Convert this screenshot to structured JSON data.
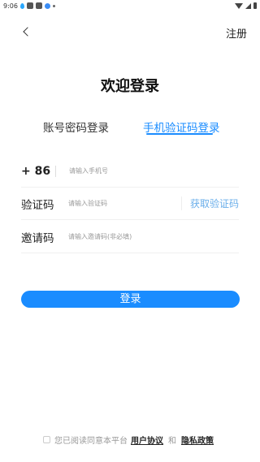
{
  "status_bar": {
    "time": "9:06"
  },
  "header": {
    "register_label": "注册"
  },
  "title": "欢迎登录",
  "tabs": [
    {
      "label": "账号密码登录",
      "active": false
    },
    {
      "label": "手机验证码登录",
      "active": true
    }
  ],
  "form": {
    "phone": {
      "prefix": "+ 86",
      "placeholder": "请输入手机号",
      "value": ""
    },
    "code": {
      "label": "验证码",
      "placeholder": "请输入验证码",
      "value": "",
      "get_code_label": "获取验证码"
    },
    "invite": {
      "label": "邀请码",
      "placeholder": "请输入邀请码(非必填)",
      "value": ""
    }
  },
  "login_button": "登录",
  "agreement": {
    "checked": false,
    "text": "您已阅读同意本平台",
    "user_agreement": "用户协议",
    "and": "和",
    "privacy_policy": "隐私政策"
  },
  "colors": {
    "accent": "#1a8cff",
    "get_code": "#6aaeea"
  },
  "icons": {
    "back": "chevron-left-icon"
  }
}
